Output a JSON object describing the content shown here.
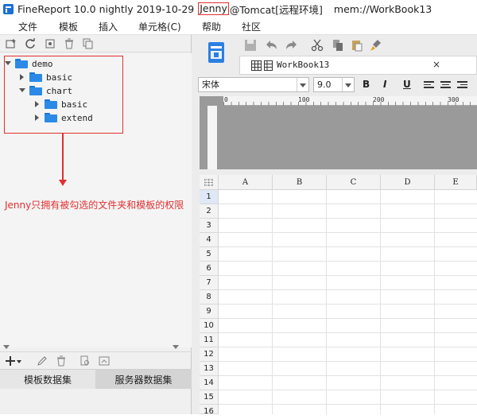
{
  "title": {
    "app": "FineReport 10.0 nightly 2019-10-29",
    "user": "Jenny",
    "server": "@Tomcat[远程环境]",
    "workbook_path": "mem://WorkBook13"
  },
  "menu": [
    "文件",
    "模板",
    "插入",
    "单元格(C)",
    "帮助",
    "社区"
  ],
  "tree": {
    "root": "demo",
    "items": [
      {
        "label": "basic"
      },
      {
        "label": "chart"
      },
      {
        "label": "basic"
      },
      {
        "label": "extend"
      }
    ]
  },
  "annotation": "Jenny只拥有被勾选的文件夹和模板的权限",
  "dataset_tabs": [
    "模板数据集",
    "服务器数据集"
  ],
  "editor": {
    "tab_label": "WorkBook13",
    "tab_close": "×",
    "font_name": "宋体",
    "font_size": "9.0",
    "bold": "B",
    "italic": "I",
    "underline": "U"
  },
  "ruler": [
    "0",
    "100",
    "200",
    "300"
  ],
  "sheet": {
    "columns": [
      "A",
      "B",
      "C",
      "D",
      "E"
    ],
    "rows": [
      "1",
      "2",
      "3",
      "4",
      "5",
      "6",
      "7",
      "8",
      "9",
      "10",
      "11",
      "12",
      "13",
      "14",
      "15",
      "16"
    ]
  },
  "colors": {
    "accent_red": "#e03030",
    "folder_blue": "#2b8ae6"
  }
}
